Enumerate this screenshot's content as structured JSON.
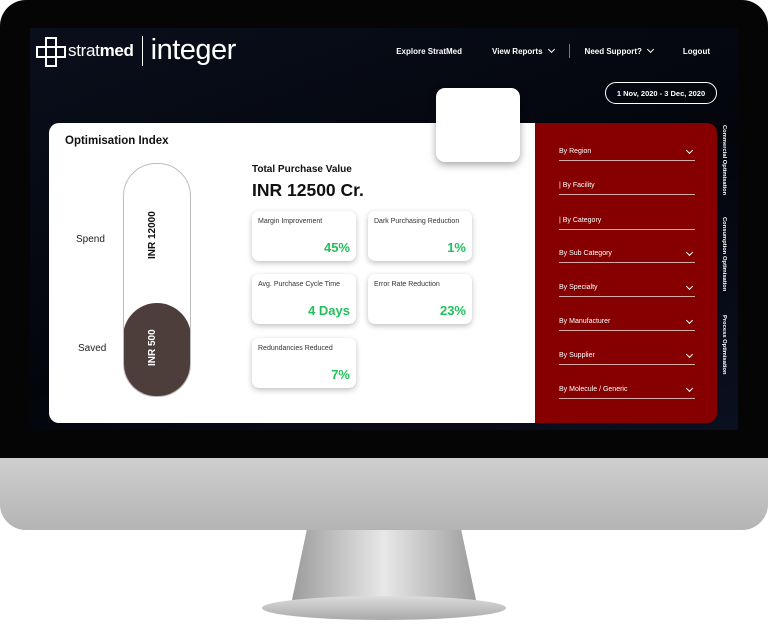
{
  "header": {
    "logo_strat_light": "strat",
    "logo_strat_bold": "med",
    "logo_product": "integer",
    "nav": [
      {
        "label": "Explore StratMed",
        "has_chevron": false
      },
      {
        "label": "View Reports",
        "has_chevron": true
      },
      {
        "label": "Need Support?",
        "has_chevron": true
      },
      {
        "label": "Logout",
        "has_chevron": false
      }
    ],
    "date_range": "1 Nov, 2020 - 3 Dec, 2020"
  },
  "optimisation": {
    "title": "Optimisation Index",
    "spend_label": "Spend",
    "saved_label": "Saved",
    "spend_value": "INR 12000",
    "saved_value": "INR 500"
  },
  "purchase": {
    "label": "Total Purchase Value",
    "value": "INR 12500 Cr."
  },
  "metrics": [
    {
      "label": "Margin Improvement",
      "value": "45%"
    },
    {
      "label": "Dark Purchasing Reduction",
      "value": "1%"
    },
    {
      "label": "Avg. Purchase Cycle Time",
      "value": "4 Days"
    },
    {
      "label": "Error Rate Reduction",
      "value": "23%"
    },
    {
      "label": "Redundancies Reduced",
      "value": "7%"
    }
  ],
  "filters": [
    {
      "label": "By Region",
      "has_chevron": true
    },
    {
      "label": "| By Facility",
      "has_chevron": false
    },
    {
      "label": "| By Category",
      "has_chevron": false
    },
    {
      "label": "By Sub Category",
      "has_chevron": true
    },
    {
      "label": "By Specialty",
      "has_chevron": true
    },
    {
      "label": "By Manufacturer",
      "has_chevron": true
    },
    {
      "label": "By Supplier",
      "has_chevron": true
    },
    {
      "label": "By Molecule / Generic",
      "has_chevron": true
    }
  ],
  "side_tabs": [
    "Commercial Optimisation",
    "Consumption Optimisation",
    "Process Optimisation"
  ],
  "colors": {
    "accent_red": "#860000",
    "positive_green": "#22c05a",
    "saved_brown": "#4d3e3b"
  }
}
